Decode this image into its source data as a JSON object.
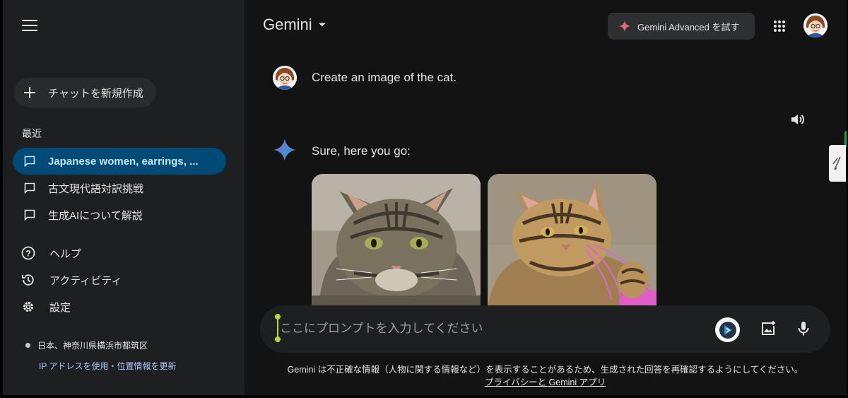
{
  "sidebar": {
    "new_chat_label": "チャットを新規作成",
    "recent_heading": "最近",
    "recent_chats": [
      {
        "label": "Japanese women, earrings, ..."
      },
      {
        "label": "古文現代語対訳挑戦"
      },
      {
        "label": "生成AIについて解説"
      }
    ],
    "links": {
      "help": "ヘルプ",
      "activity": "アクティビティ",
      "settings": "設定"
    },
    "location": "日本、神奈川県横浜市都筑区",
    "location_update": "IP アドレスを使用・位置情報を更新"
  },
  "header": {
    "title": "Gemini",
    "advanced_label": "Gemini Advanced を試す"
  },
  "chat": {
    "user_message": "Create an image of the cat.",
    "bot_message": "Sure, here you go:"
  },
  "input": {
    "placeholder": "ここにプロンプトを入力してください"
  },
  "footer": {
    "disclaimer": "Gemini は不正確な情報（人物に関する情報など）を表示することがあるため、生成された回答を再確認するようにしてください。",
    "privacy_link": "プライバシーと Gemini アプリ"
  },
  "colors": {
    "background": "#131314",
    "sidebar": "#1e1f20",
    "active_chat": "#004a77",
    "link": "#a8c7fa"
  }
}
